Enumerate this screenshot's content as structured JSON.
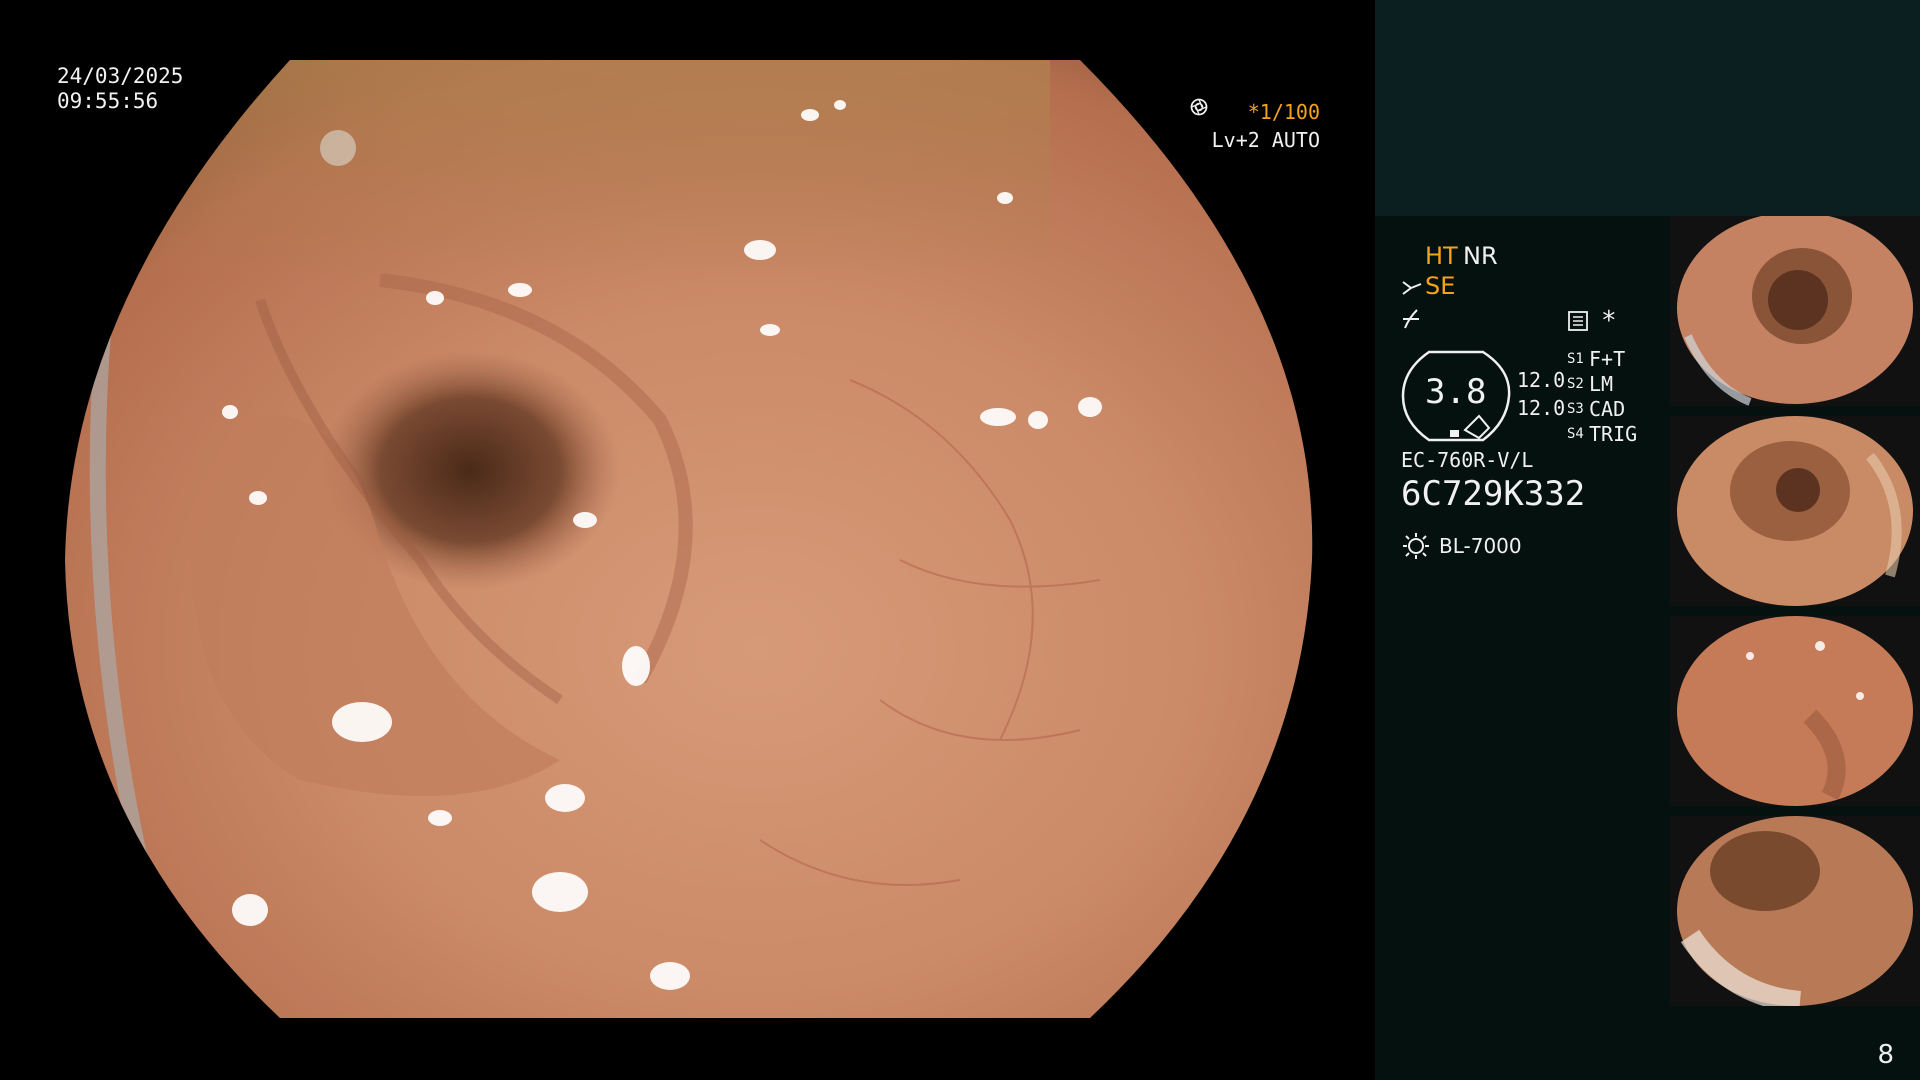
{
  "overlay": {
    "date": "24/03/2025",
    "time": "09:55:56",
    "shutter": "*1/100",
    "iris": "Lv+2 AUTO",
    "shutter_icon": "aperture-icon",
    "iris_icon": "iris-icon"
  },
  "settings": {
    "ht": "HT",
    "nr": "NR",
    "se": "SE",
    "scissor_icon": "scissor-icon",
    "contrast_icon": "contrast-icon",
    "memo_icon": "memo-icon",
    "star": "*",
    "zoom": "3.8",
    "val1": "12.0",
    "val2": "12.0",
    "s1_label": "S1",
    "s1_value": "F+T",
    "s2_label": "S2",
    "s2_value": "LM",
    "s3_label": "S3",
    "s3_value": "CAD",
    "s4_label": "S4",
    "s4_value": "TRIG",
    "scope_model": "EC-760R-V/L",
    "serial": "6C729K332",
    "light_source": "BL-7000",
    "light_icon": "light-source-icon"
  },
  "thumbnails": [
    {
      "name": "thumbnail-1"
    },
    {
      "name": "thumbnail-2"
    },
    {
      "name": "thumbnail-3"
    },
    {
      "name": "thumbnail-4"
    }
  ],
  "page_number": "8",
  "colors": {
    "accent_orange": "#f7a21b",
    "panel_dark": "#05110f",
    "panel_top": "#0b1f21",
    "mucosa": "#c98665"
  }
}
